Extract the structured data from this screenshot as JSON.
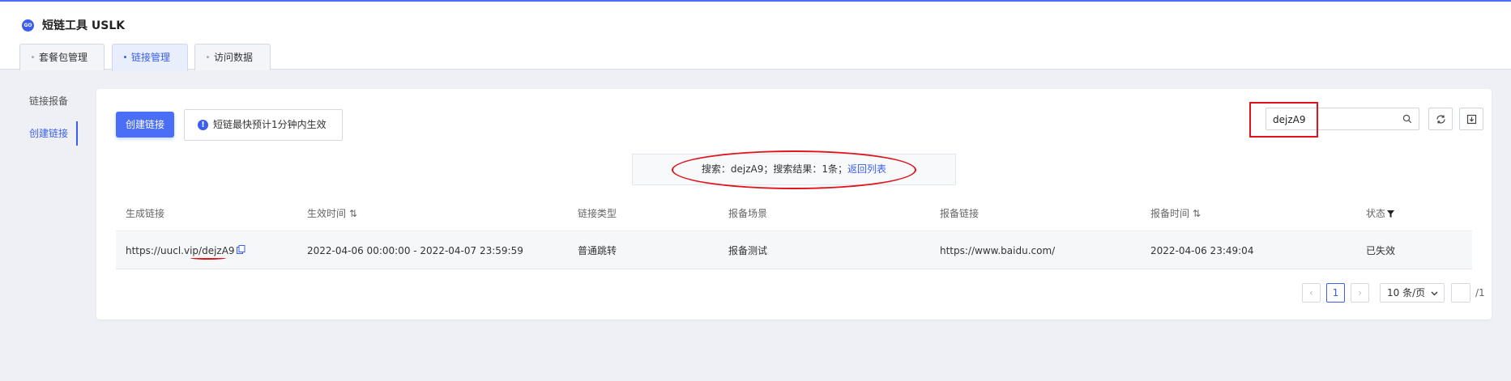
{
  "app": {
    "logo_text": "GO",
    "title": "短链工具 USLK"
  },
  "tabs": [
    {
      "label": "套餐包管理",
      "active": false
    },
    {
      "label": "链接管理",
      "active": true
    },
    {
      "label": "访问数据",
      "active": false
    }
  ],
  "sidebar": {
    "items": [
      {
        "label": "链接报备",
        "active": false
      },
      {
        "label": "创建链接",
        "active": true
      }
    ]
  },
  "toolbar": {
    "create_button": "创建链接",
    "notice": "短链最快预计1分钟内生效",
    "search_value": "dejzA9"
  },
  "search_result": {
    "text": "搜索：dejzA9；搜索结果：1条；",
    "back_link": "返回列表"
  },
  "table": {
    "columns": [
      "生成链接",
      "生效时间",
      "链接类型",
      "报备场景",
      "报备链接",
      "报备时间",
      "状态"
    ],
    "rows": [
      {
        "link_prefix": "https://uucl.vip/",
        "link_code": "dejzA9",
        "effective_time": "2022-04-06 00:00:00 - 2022-04-07 23:59:59",
        "type": "普通跳转",
        "scene": "报备测试",
        "report_url": "https://www.baidu.com/",
        "report_time": "2022-04-06 23:49:04",
        "status": "已失效"
      }
    ]
  },
  "pagination": {
    "prev": "‹",
    "current_page": "1",
    "next": "›",
    "page_size": "10 条/页",
    "total_pages": "/1"
  },
  "colors": {
    "accent": "#4a6ef5",
    "annotation_red": "#e0141a"
  }
}
